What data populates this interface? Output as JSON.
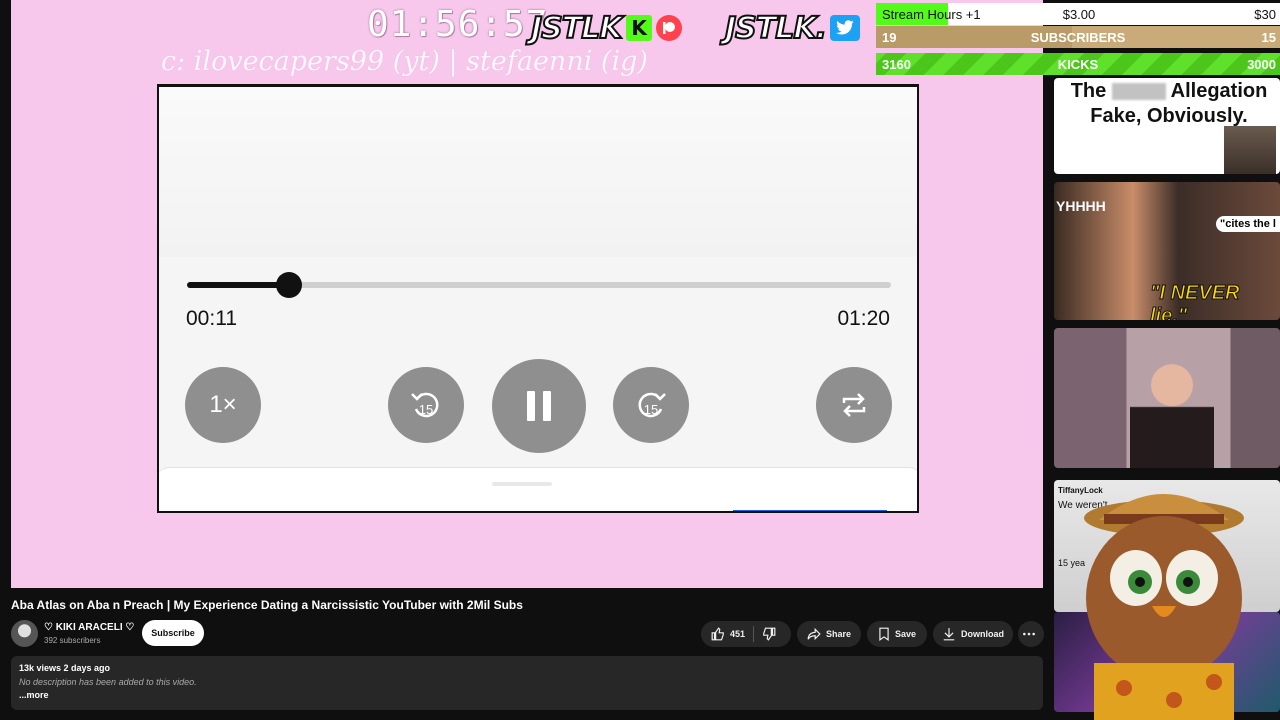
{
  "overlay": {
    "timer": "01:56:57",
    "logo_text": "JSTLK",
    "logo2_text": "JSTLK.",
    "kick_badge": "K",
    "credit": "c: ilovecapers99 (yt) | stefaenni (ig)"
  },
  "player": {
    "elapsed": "00:11",
    "duration": "01:20",
    "progress": 0.145,
    "speed_label": "1×",
    "skip_back_label": "15",
    "skip_fwd_label": "15",
    "icons": [
      "skip-back-15-icon",
      "pause-icon",
      "skip-forward-15-icon",
      "repeat-icon"
    ]
  },
  "stream_goals": {
    "hours_label": "Stream Hours +1",
    "hours_price": "$3.00",
    "hours_goal": "$30",
    "subs_current": "19",
    "subs_label": "SUBSCRIBERS",
    "subs_goal": "15",
    "kicks_current": "3160",
    "kicks_label": "KICKS",
    "kicks_goal": "3000",
    "colors": {
      "green": "#53fc18",
      "tan": "#c9ab7a"
    }
  },
  "sidebar_thumbs": {
    "t1_line1_a": "The",
    "t1_line1_b": "Allegation",
    "t1_line2": "Fake, Obviously.",
    "t2_label_a": "YHHHH",
    "t2_label_b": "\"I NEVER lie.\"",
    "t2_label_c": "\"cites the l",
    "t4_handle": "TiffanyLock",
    "t4_snippet": "We weren't",
    "t4_years": "15 yea"
  },
  "video": {
    "title": "Aba Atlas on Aba n Preach | My Experience Dating a Narcissistic YouTuber with 2Mil Subs",
    "channel_name": "♡ KIKI ARACELI ♡",
    "channel_subs": "392 subscribers",
    "subscribe_label": "Subscribe",
    "likes": "451",
    "share_label": "Share",
    "save_label": "Save",
    "download_label": "Download",
    "views_meta": "13k views  2 days ago",
    "description": "No description has been added to this video.",
    "more_label": "...more"
  }
}
